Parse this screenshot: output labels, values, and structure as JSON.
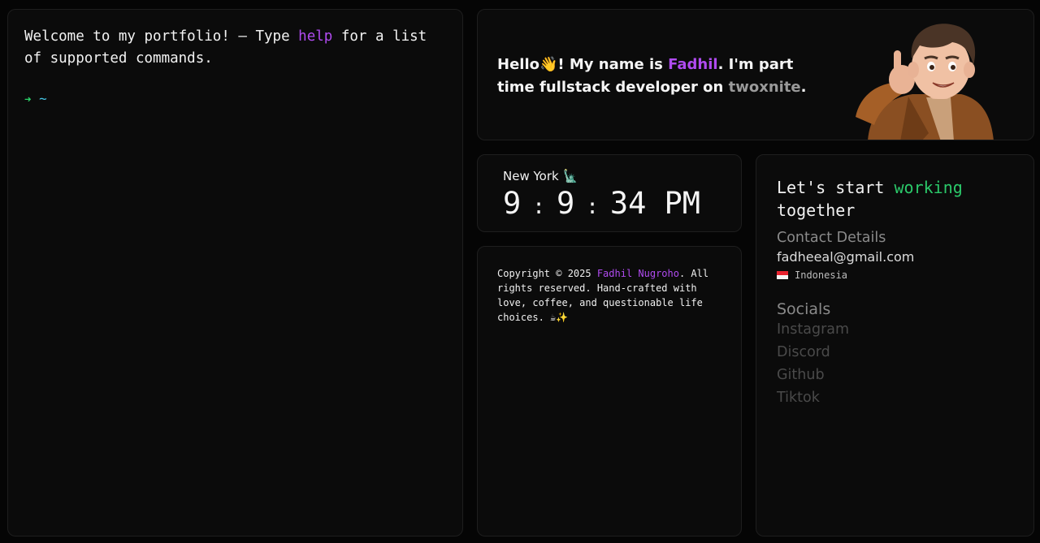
{
  "terminal": {
    "welcome_before": "Welcome to my portfolio! — Type ",
    "welcome_cmd": "help",
    "welcome_after": " for a list of supported commands.",
    "prompt_arrow": "➜",
    "prompt_dir": "~"
  },
  "intro": {
    "greeting": "Hello👋! My name is ",
    "name": "Fadhil",
    "middle": ". I'm part time fullstack developer on ",
    "company": "twoxnite",
    "end": "."
  },
  "clock": {
    "city": "New York 🗽",
    "hours": "9",
    "minutes": "9",
    "seconds": "34",
    "ampm": "PM",
    "separator": ":"
  },
  "footer": {
    "before": "Copyright © 2025 ",
    "author": "Fadhil Nugroho",
    "after": ". All rights reserved. Hand-crafted with love, coffee, and questionable life choices. ☕✨"
  },
  "contact": {
    "cta_before": "Let's start ",
    "cta_highlight": "working",
    "cta_after": " together",
    "details_title": "Contact Details",
    "email": "fadheeal@gmail.com",
    "country": "Indonesia",
    "socials_title": "Socials",
    "socials": [
      "Instagram",
      "Discord",
      "Github",
      "Tiktok"
    ]
  },
  "colors": {
    "accent_purple": "#b04bf0",
    "accent_green": "#2bc96a",
    "prompt_cyan": "#46c8e8",
    "background": "#050505",
    "panel": "#0b0b0b"
  }
}
